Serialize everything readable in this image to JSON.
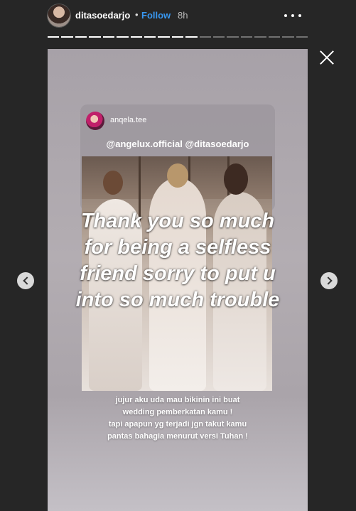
{
  "header": {
    "username": "ditasoedarjo",
    "separator": "•",
    "follow_label": "Follow",
    "time": "8h"
  },
  "progress": {
    "total_segments": 19,
    "completed_segments": 11
  },
  "story": {
    "repost_username": "anqela.tee",
    "tags": "@angelux.official @ditasoedarjo",
    "overlay_lines": [
      "Thank you so much",
      "for being a selfless",
      "friend sorry to put u",
      "into so much trouble"
    ],
    "caption_lines": [
      "jujur aku uda mau bikinin ini buat",
      "wedding pemberkatan kamu !",
      "tapi apapun yg terjadi jgn takut kamu",
      "pantas bahagia menurut versi Tuhan !"
    ]
  },
  "icons": {
    "more": "more-horizontal-icon",
    "close": "close-icon",
    "prev": "chevron-left-icon",
    "next": "chevron-right-icon"
  }
}
